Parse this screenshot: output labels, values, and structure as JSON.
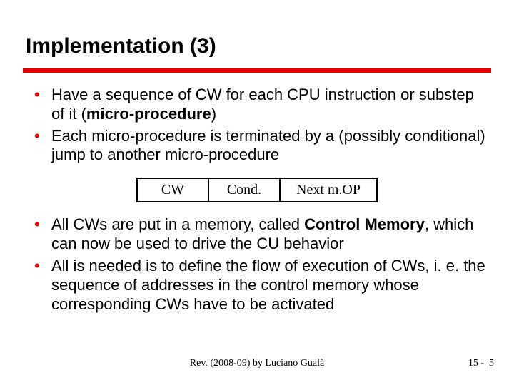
{
  "title": "Implementation (3)",
  "bullets_top": [
    {
      "pre": "Have a sequence of CW for each CPU instruction or substep of it (",
      "bold": "micro-procedure",
      "post": ")"
    },
    {
      "pre": "Each micro-procedure is terminated by a (possibly conditional) jump to another micro-procedure",
      "bold": "",
      "post": ""
    }
  ],
  "cells": {
    "c1": "CW",
    "c2": "Cond.",
    "c3": "Next m.OP"
  },
  "bullets_bottom": [
    {
      "pre": "All CWs are put in a memory, called ",
      "bold": "Control Memory",
      "post": ", which can now be used to drive the CU behavior"
    },
    {
      "pre": "All is needed is to define the flow of execution of CWs, i. e. the sequence of addresses in the control memory whose corresponding CWs have to be activated",
      "bold": "",
      "post": ""
    }
  ],
  "footer": {
    "rev": "Rev. (2008-09) by Luciano Gualà",
    "page_prefix": "15 -",
    "page_num": "5"
  }
}
